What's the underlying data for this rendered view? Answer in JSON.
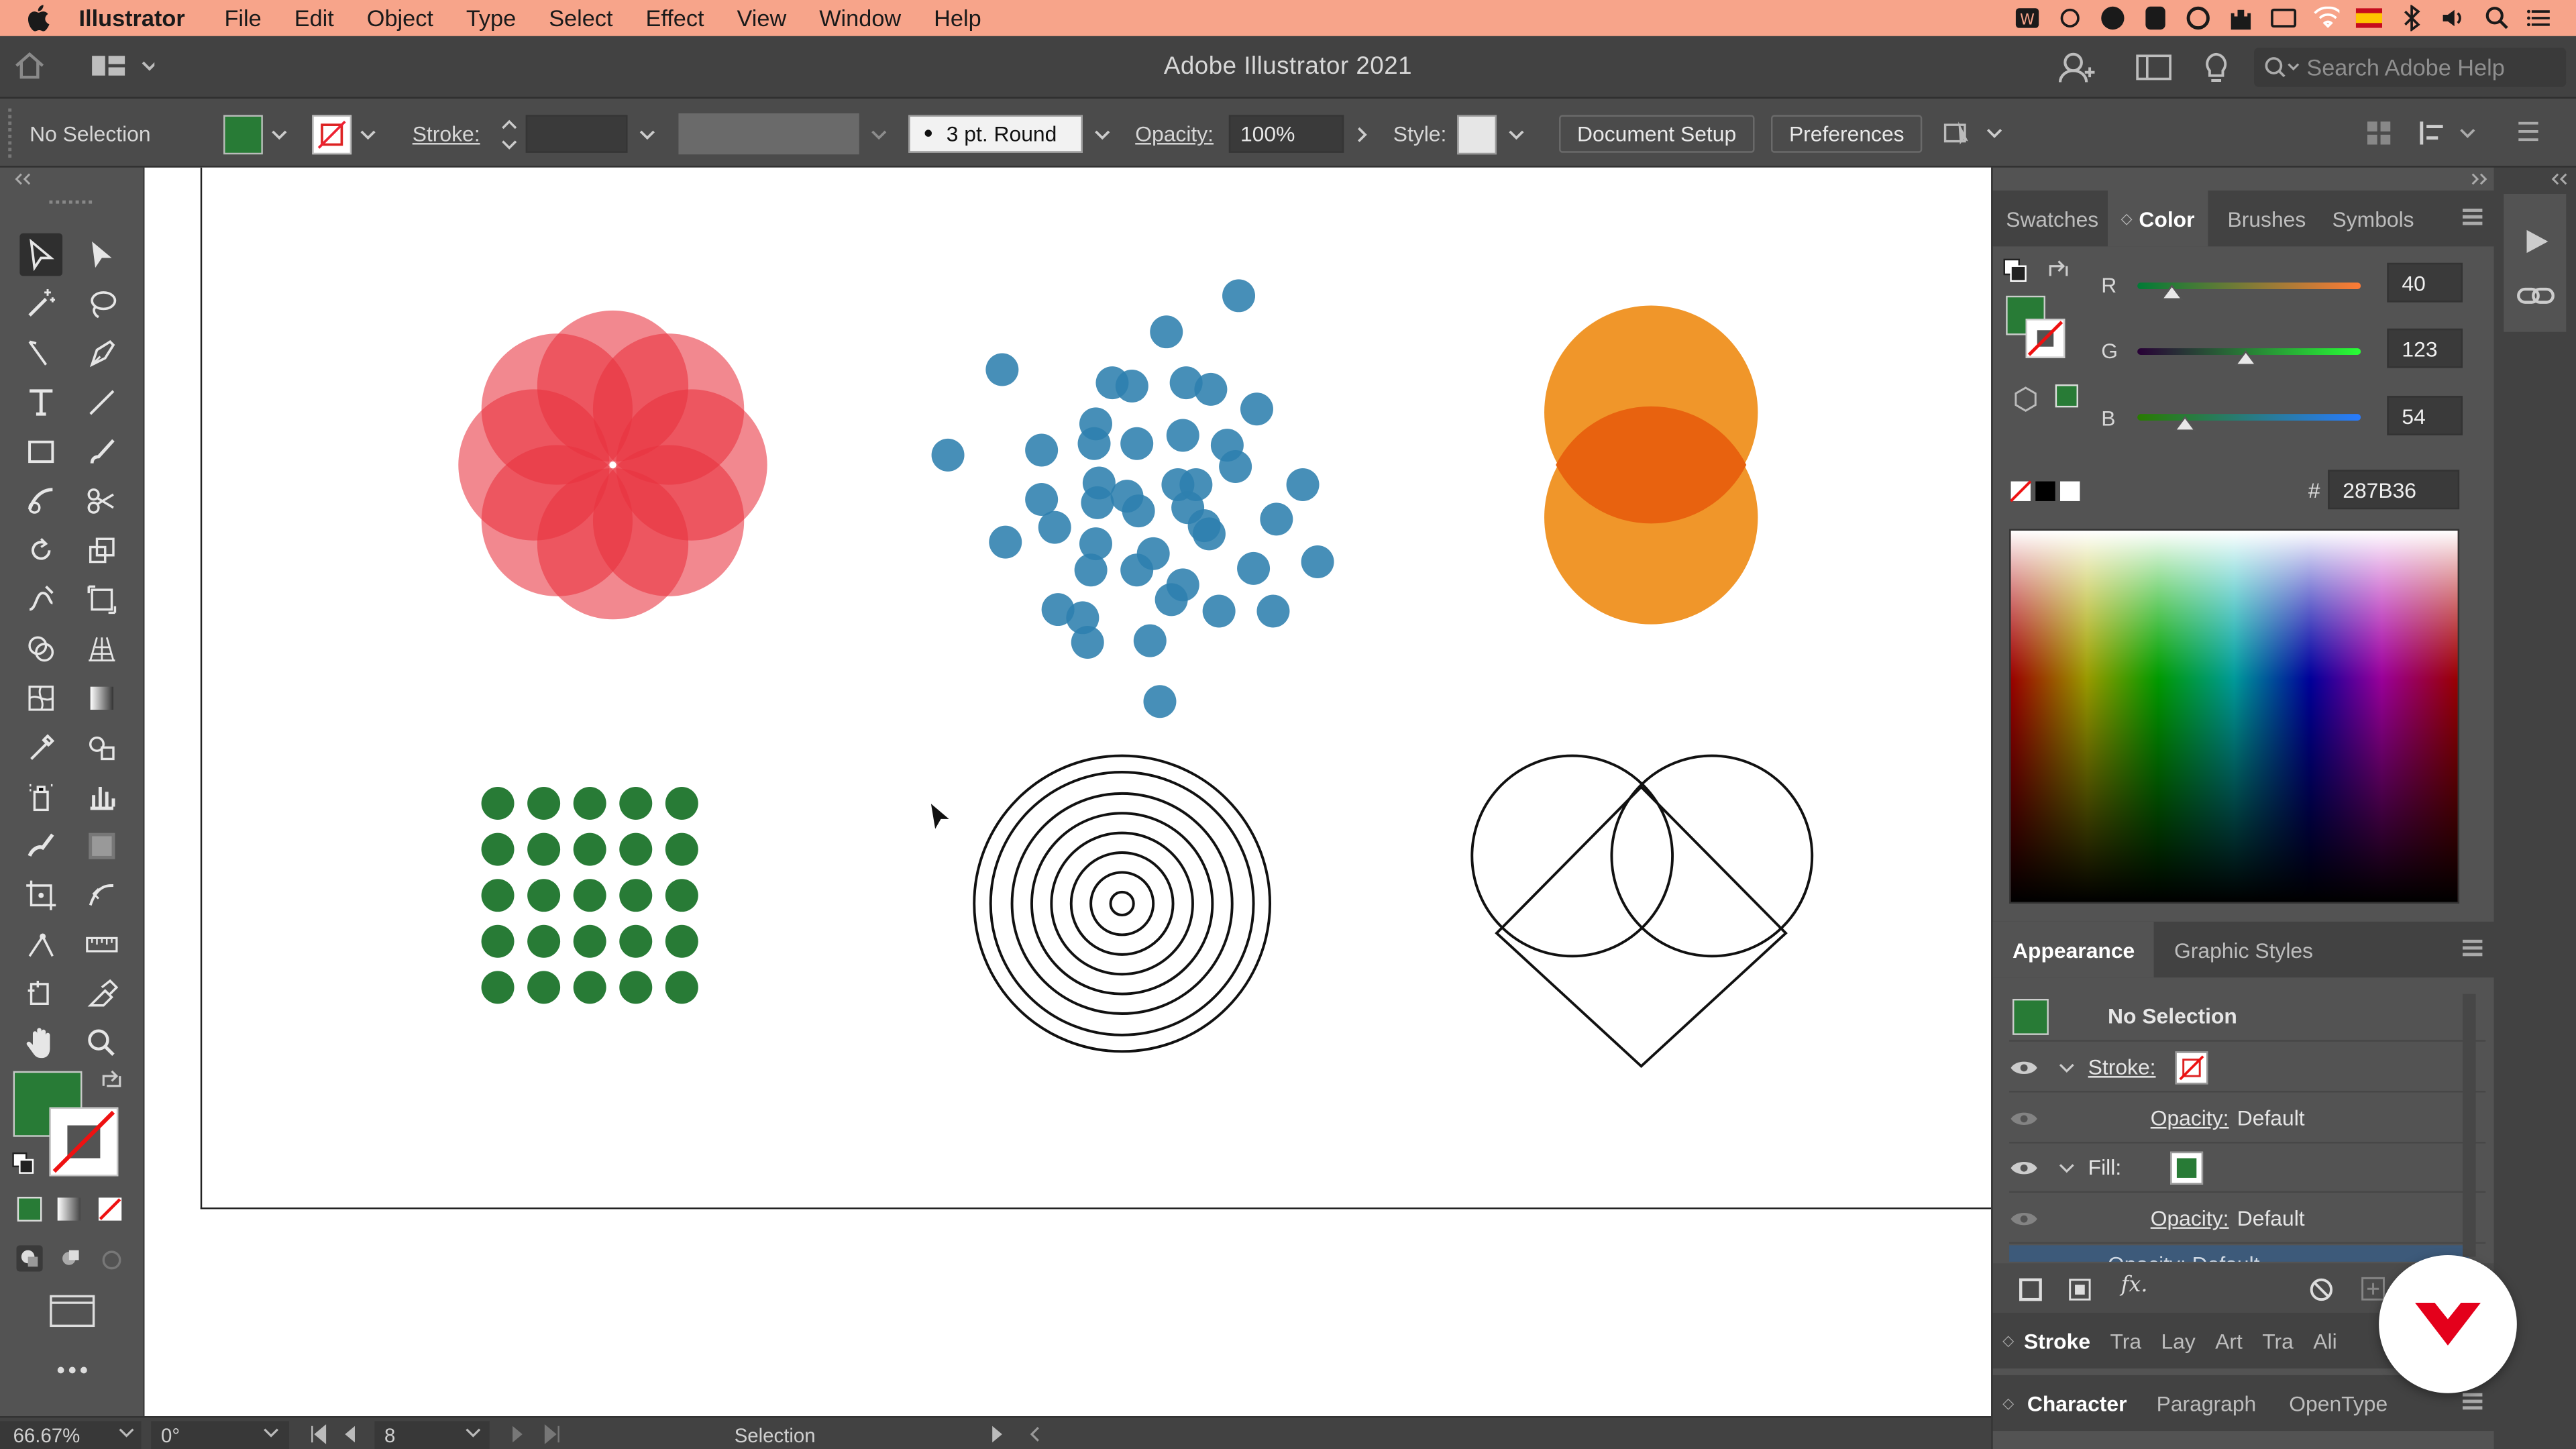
{
  "menubar": {
    "app_name": "Illustrator",
    "items": [
      "File",
      "Edit",
      "Object",
      "Type",
      "Select",
      "Effect",
      "View",
      "Window",
      "Help"
    ]
  },
  "appbar": {
    "title": "Adobe Illustrator 2021",
    "search_placeholder": "Search Adobe Help"
  },
  "control": {
    "selection": "No Selection",
    "stroke_label": "Stroke:",
    "brush": "3 pt. Round",
    "opacity_label": "Opacity:",
    "opacity_value": "100%",
    "style_label": "Style:",
    "document_setup": "Document Setup",
    "preferences": "Preferences"
  },
  "colors": {
    "fill": "#287B36",
    "flower": "#e8323e",
    "dots": "#2e7fae",
    "orange": "#f0962a",
    "orange_overlap": "#e8620f"
  },
  "color_panel": {
    "tabs": [
      "Swatches",
      "Color",
      "Brushes",
      "Symbols"
    ],
    "active_tab": "Color",
    "r_label": "R",
    "r_value": "40",
    "g_label": "G",
    "g_value": "123",
    "b_label": "B",
    "b_value": "54",
    "hash": "#",
    "hex": "287B36"
  },
  "appearance": {
    "tabs": [
      "Appearance",
      "Graphic Styles"
    ],
    "active_tab": "Appearance",
    "title": "No Selection",
    "stroke_label": "Stroke:",
    "opacity_label": "Opacity:",
    "opacity_value": "Default",
    "fill_label": "Fill:",
    "opacity2_label": "Opacity:",
    "opacity2_value": "Default",
    "partial_row": "Opacity: Default",
    "fx": "fx."
  },
  "bottom_panels": {
    "row1": [
      "Stroke",
      "Tra",
      "Lay",
      "Art",
      "Tra",
      "Ali"
    ],
    "row2": [
      "Character",
      "Paragraph",
      "OpenType"
    ]
  },
  "status": {
    "zoom": "66.67%",
    "rotation": "0°",
    "artboard": "8",
    "tool": "Selection"
  }
}
